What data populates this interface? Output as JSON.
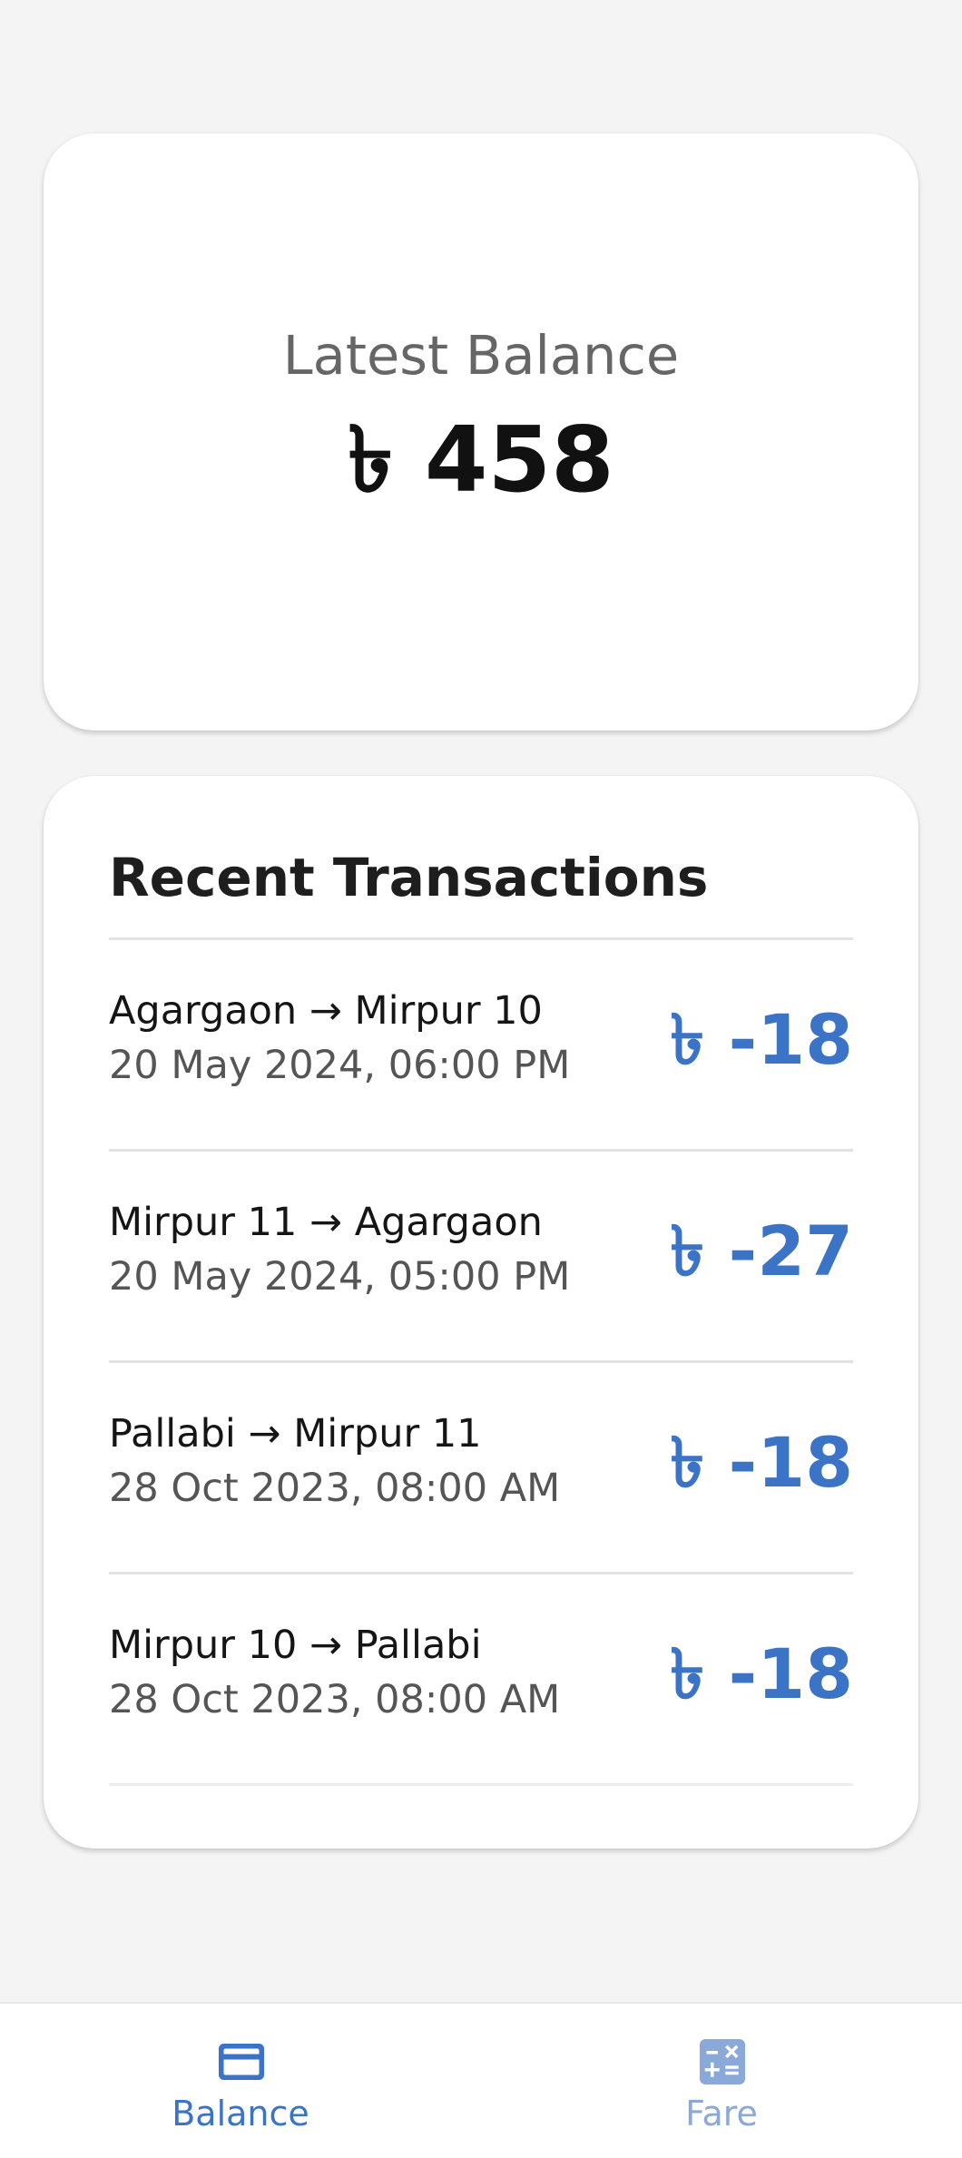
{
  "balance": {
    "label": "Latest Balance",
    "amount": "৳ 458"
  },
  "transactions": {
    "title": "Recent Transactions",
    "items": [
      {
        "route": "Agargaon → Mirpur 10",
        "datetime": "20 May 2024, 06:00 PM",
        "amount": "৳ -18"
      },
      {
        "route": "Mirpur 11 → Agargaon",
        "datetime": "20 May 2024, 05:00 PM",
        "amount": "৳ -27"
      },
      {
        "route": "Pallabi → Mirpur 11",
        "datetime": "28 Oct 2023, 08:00 AM",
        "amount": "৳ -18"
      },
      {
        "route": "Mirpur 10 → Pallabi",
        "datetime": "28 Oct 2023, 08:00 AM",
        "amount": "৳ -18"
      }
    ]
  },
  "bottom_nav": {
    "items": [
      {
        "label": "Balance",
        "icon": "credit-card-icon",
        "active": true
      },
      {
        "label": "Fare",
        "icon": "calculator-icon",
        "active": false
      }
    ]
  },
  "colors": {
    "accent": "#3b73c6",
    "inactive_nav": "#8aa8d8",
    "background": "#f4f4f4",
    "card": "#ffffff"
  }
}
